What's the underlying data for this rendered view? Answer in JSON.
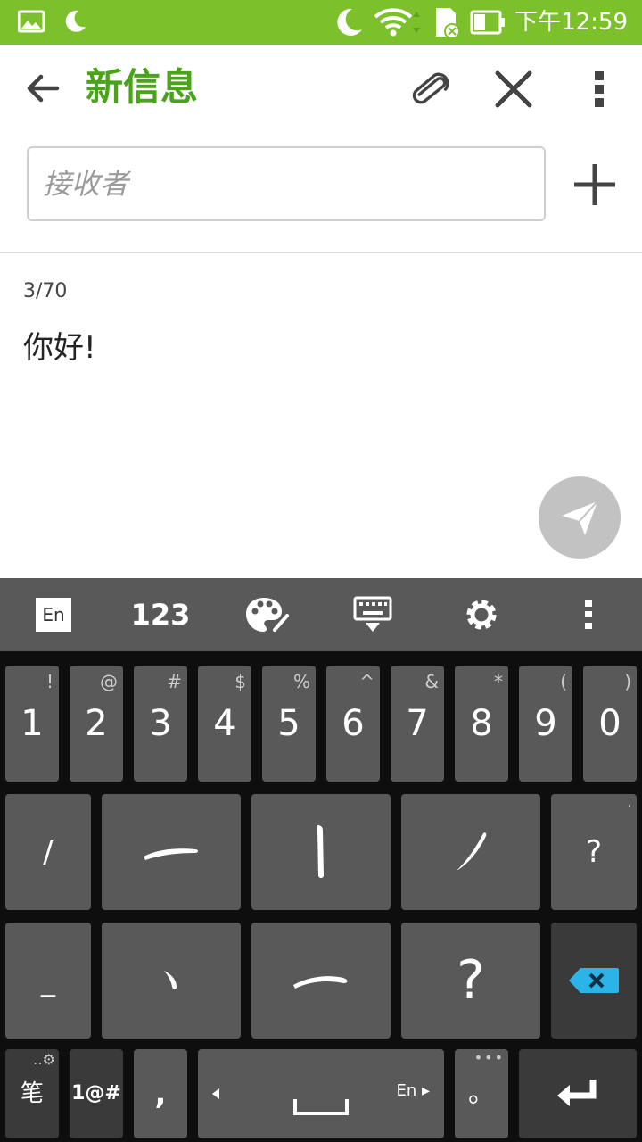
{
  "status_bar": {
    "time": "下午12:59",
    "accent_color": "#7cc12b"
  },
  "toolbar": {
    "title": "新信息",
    "title_color": "#4aa31b",
    "icons": [
      "back-arrow-icon",
      "attach-icon",
      "close-icon",
      "more-vert-icon"
    ]
  },
  "recipient": {
    "placeholder": "接收者"
  },
  "message": {
    "counter": "3/70",
    "text": "你好!"
  },
  "keyboard": {
    "toolbar": {
      "lang": "En",
      "num": "123"
    },
    "row1": [
      {
        "main": "1",
        "sec": "!"
      },
      {
        "main": "2",
        "sec": "@"
      },
      {
        "main": "3",
        "sec": "#"
      },
      {
        "main": "4",
        "sec": "$"
      },
      {
        "main": "5",
        "sec": "%"
      },
      {
        "main": "6",
        "sec": "^"
      },
      {
        "main": "7",
        "sec": "&"
      },
      {
        "main": "8",
        "sec": "*"
      },
      {
        "main": "9",
        "sec": "("
      },
      {
        "main": "0",
        "sec": ")"
      }
    ],
    "row2": {
      "slash": "/",
      "q": "?"
    },
    "row3": {
      "underscore": "_",
      "q": "?"
    },
    "row4": {
      "stroke_mode": "笔",
      "symbols": "1@#",
      "comma": ",",
      "lang": "En",
      "period": "。"
    }
  }
}
